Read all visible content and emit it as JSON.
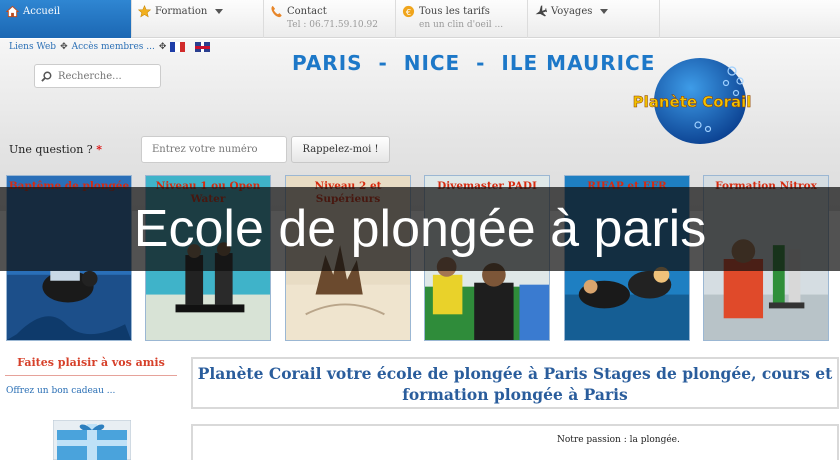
{
  "nav": {
    "items": [
      {
        "label": "Accueil",
        "sub": "",
        "icon": "home-icon",
        "active": true
      },
      {
        "label": "Formation",
        "sub": "",
        "icon": "star-icon",
        "dropdown": true
      },
      {
        "label": "Contact",
        "sub": "Tel : 06.71.59.10.92",
        "icon": "phone-icon"
      },
      {
        "label": "Tous les tarifs",
        "sub": "en un clin d'oeil ...",
        "icon": "euro-icon"
      },
      {
        "label": "Voyages",
        "sub": "",
        "icon": "airplane-icon",
        "dropdown": true
      }
    ]
  },
  "header": {
    "links_label": "Liens Web",
    "members_label": "Accès membres ...",
    "search_placeholder": "Recherche...",
    "headline": "PARIS  -  NICE  -  ILE MAURICE",
    "logo_text": "Planète Corail",
    "question_label": "Une question ?",
    "question_star": "*",
    "phone_placeholder": "Entrez votre numéro",
    "callback_label": "Rappelez-moi !"
  },
  "cards": [
    {
      "title": "Baptême de plongée"
    },
    {
      "title": "Niveau 1 ou Open Water"
    },
    {
      "title": "Niveau 2 et Supérieurs"
    },
    {
      "title": "Divemaster PADI"
    },
    {
      "title": "RIFAP et EFR"
    },
    {
      "title": "Formation Nitrox"
    }
  ],
  "overlay": {
    "text": "Ecole de plongée à paris"
  },
  "sidebar": {
    "gift_title": "Faites plaisir à vos amis",
    "gift_link": "Offrez un bon cadeau ..."
  },
  "main": {
    "title": "Planète Corail votre école de plongée à Paris Stages de plongée, cours et formation plongée à Paris",
    "passion": "Notre passion : la plongée."
  },
  "colors": {
    "accent": "#1d78c8",
    "card_title": "#d62b10",
    "nav_active": "#2477c4"
  }
}
